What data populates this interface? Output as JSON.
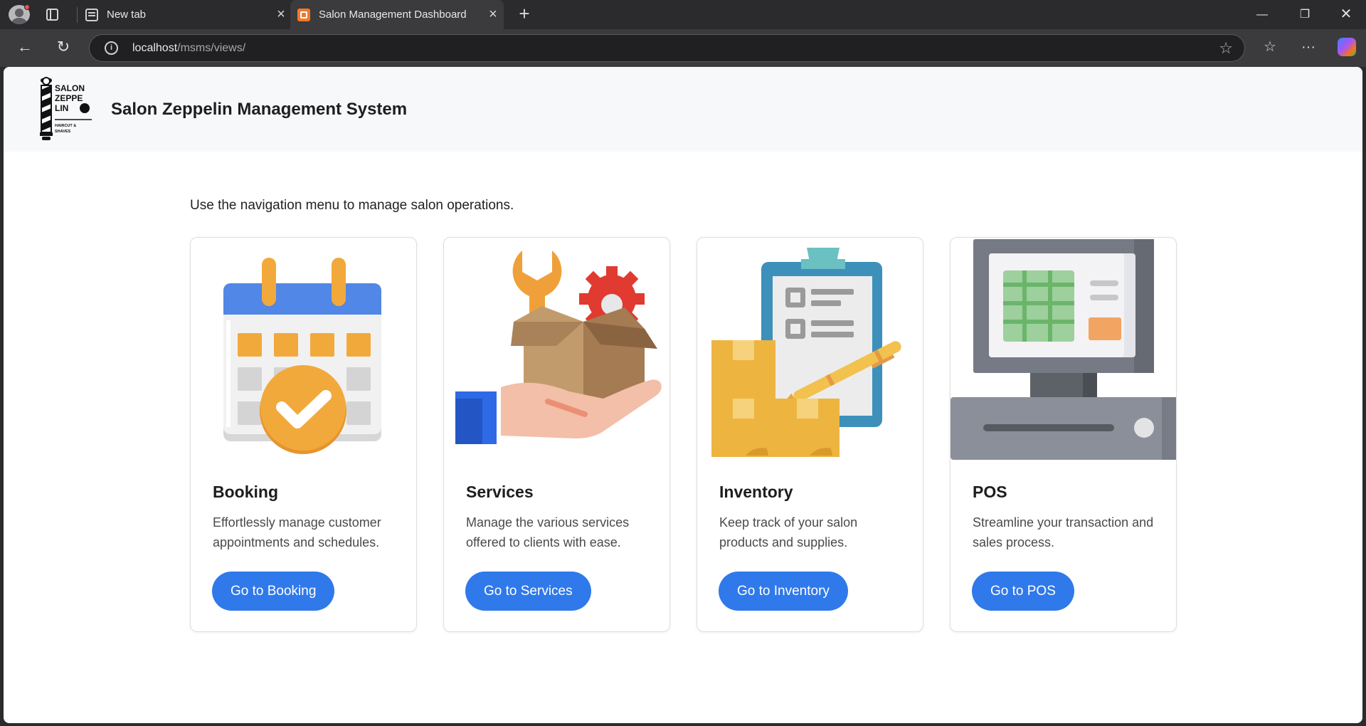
{
  "browser": {
    "tabs": [
      {
        "label": "New tab",
        "active": false,
        "icon": "new-tab-page-icon"
      },
      {
        "label": "Salon Management Dashboard",
        "active": true,
        "icon": "xampp-icon"
      }
    ],
    "address": {
      "host": "localhost",
      "path": "/msms/views/"
    }
  },
  "header": {
    "title": "Salon Zeppelin Management System",
    "logo_text": [
      "SALON",
      "ZEPPE",
      "LIN",
      "HAIRCUT &",
      "SHAVES"
    ]
  },
  "main": {
    "intro": "Use the navigation menu to manage salon operations.",
    "cards": [
      {
        "title": "Booking",
        "description": "Effortlessly manage customer appointments and schedules.",
        "button": "Go to Booking",
        "icon": "calendar-check-icon"
      },
      {
        "title": "Services",
        "description": "Manage the various services offered to clients with ease.",
        "button": "Go to Services",
        "icon": "service-box-icon"
      },
      {
        "title": "Inventory",
        "description": "Keep track of your salon products and supplies.",
        "button": "Go to Inventory",
        "icon": "clipboard-boxes-icon"
      },
      {
        "title": "POS",
        "description": "Streamline your transaction and sales process.",
        "button": "Go to POS",
        "icon": "cash-register-icon"
      }
    ]
  },
  "colors": {
    "accent": "#2f79ea",
    "header_bg": "#f7f8f9"
  }
}
